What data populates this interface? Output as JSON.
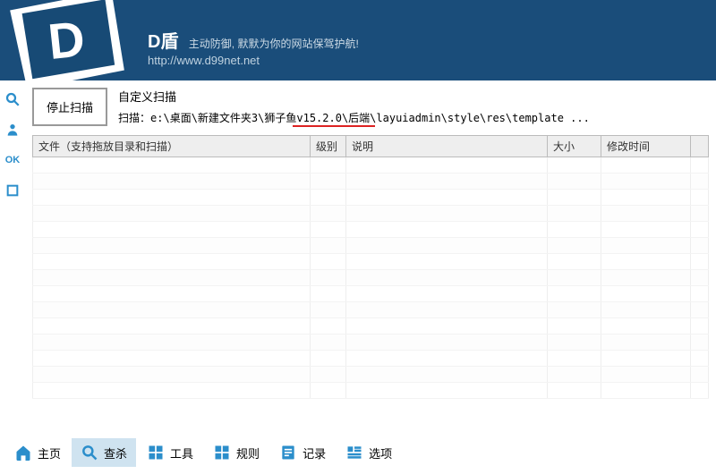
{
  "header": {
    "logo_letter": "D",
    "title": "D盾",
    "subtitle": "主动防御, 默默为你的网站保驾护航!",
    "url": "http://www.d99net.net"
  },
  "sidebar": {
    "ok_label": "OK"
  },
  "scan": {
    "stop_label": "停止扫描",
    "title": "自定义扫描",
    "path_prefix": "扫描：",
    "path": "e:\\桌面\\新建文件夹3\\狮子鱼v15.2.0\\后端\\layuiadmin\\style\\res\\template ..."
  },
  "columns": {
    "file": "文件（支持拖放目录和扫描）",
    "level": "级别",
    "desc": "说明",
    "size": "大小",
    "mtime": "修改时间"
  },
  "tabs": {
    "home": "主页",
    "scan": "查杀",
    "tools": "工具",
    "rules": "规则",
    "log": "记录",
    "options": "选项"
  }
}
